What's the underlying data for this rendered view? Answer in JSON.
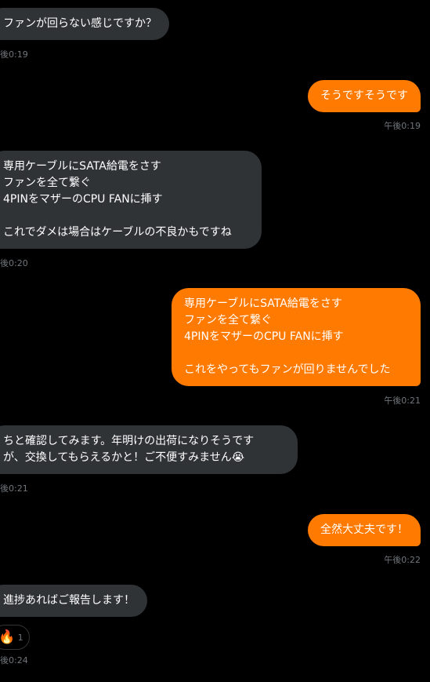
{
  "messages": [
    {
      "direction": "incoming",
      "text": "ファンが回らない感じですか？",
      "time": "後0:19"
    },
    {
      "direction": "outgoing",
      "text": "そうですそうです",
      "time": "午後0:19"
    },
    {
      "direction": "incoming",
      "text": "専用ケーブルにSATA給電をさす\nファンを全て繋ぐ\n4PINをマザーのCPU FANに挿す\n\nこれでダメは場合はケーブルの不良かもですね",
      "time": "後0:20"
    },
    {
      "direction": "outgoing",
      "text": "専用ケーブルにSATA給電をさす\nファンを全て繋ぐ\n4PINをマザーのCPU FANに挿す\n\nこれをやってもファンが回りませんでした",
      "time": "午後0:21"
    },
    {
      "direction": "incoming",
      "text": "ちと確認してみます。年明けの出荷になりそうです\nが、交換してもらえるかと！ご不便すみません😭",
      "time": "後0:21"
    },
    {
      "direction": "outgoing",
      "text": "全然大丈夫です！",
      "time": "午後0:22"
    },
    {
      "direction": "incoming",
      "text": "進捗あればご報告します！",
      "time": "後0:24"
    }
  ],
  "reaction": {
    "emoji": "🔥",
    "icon": "fire-icon",
    "count": "1"
  },
  "colors": {
    "incoming_bubble": "#2f3336",
    "outgoing_bubble": "#ff7a00",
    "timestamp": "#71767b",
    "background": "#000000"
  }
}
